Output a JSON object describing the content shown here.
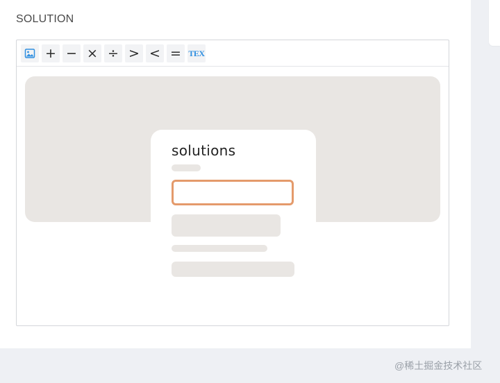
{
  "section": {
    "title": "SOLUTION"
  },
  "toolbar": {
    "buttons": [
      {
        "name": "insert-image-button",
        "icon": "image-icon",
        "glyph": ""
      },
      {
        "name": "plus-button",
        "icon": "plus-icon",
        "glyph": "+"
      },
      {
        "name": "minus-button",
        "icon": "minus-icon",
        "glyph": "−"
      },
      {
        "name": "multiply-button",
        "icon": "multiply-icon",
        "glyph": "×"
      },
      {
        "name": "divide-button",
        "icon": "divide-icon",
        "glyph": "÷"
      },
      {
        "name": "greater-than-button",
        "icon": "greater-than-icon",
        "glyph": ">"
      },
      {
        "name": "less-than-button",
        "icon": "less-than-icon",
        "glyph": "<"
      },
      {
        "name": "equals-button",
        "icon": "equals-icon",
        "glyph": "="
      },
      {
        "name": "tex-button",
        "icon": "tex-icon",
        "glyph": "TEX"
      }
    ]
  },
  "illustration": {
    "title": "solutions",
    "input_accent": "#e49a6b"
  },
  "colors": {
    "canvas": "#e9e6e3",
    "accent_blue": "#2f8fe0",
    "page_bg": "#eef0f4"
  },
  "watermark": "@稀土掘金技术社区"
}
